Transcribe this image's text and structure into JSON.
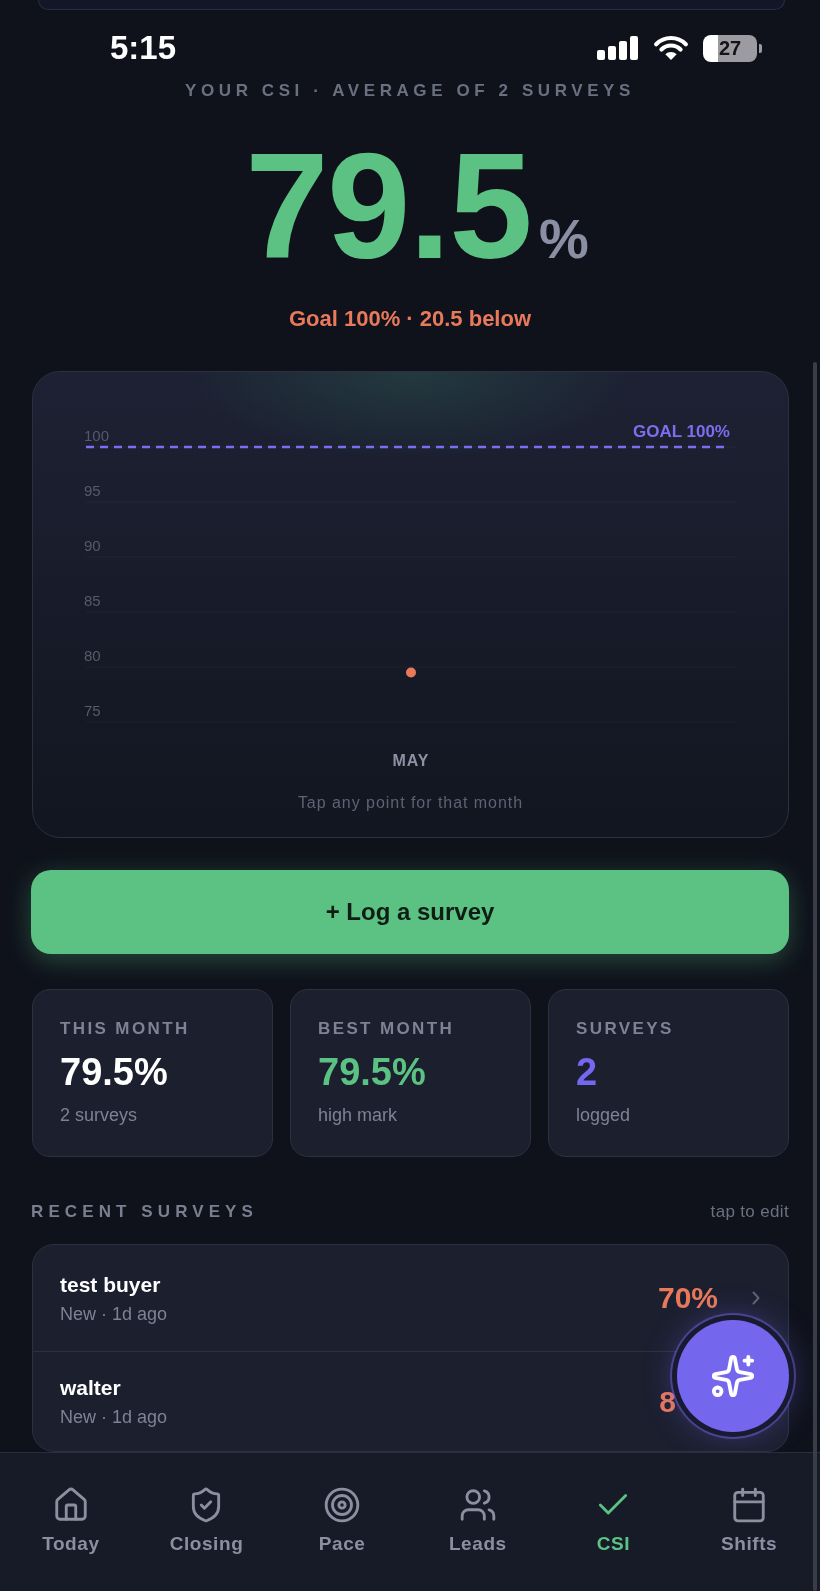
{
  "status_bar": {
    "time": "5:15",
    "battery": "27"
  },
  "header": {
    "subtitle": "YOUR CSI · AVERAGE OF 2 SURVEYS",
    "score": "79.5",
    "unit": "%",
    "goal_note": "Goal 100% · 20.5 below"
  },
  "chart": {
    "caption": "Tap any point for that month",
    "chart_data": {
      "type": "line",
      "categories": [
        "MAY"
      ],
      "series": [
        {
          "color": "#e8795a",
          "marker": "circle",
          "values": [
            79.5
          ]
        }
      ],
      "ylim": [
        75,
        100
      ],
      "yticks": [
        75,
        80,
        85,
        90,
        95,
        100
      ],
      "ref_lines": [
        {
          "axis": "y",
          "value": 100,
          "label": "GOAL 100%",
          "color": "#7b6ff0"
        }
      ]
    }
  },
  "log_button": "+ Log a survey",
  "stats": [
    {
      "label": "THIS MONTH",
      "value": "79.5%",
      "note": "2 surveys",
      "color": "#ffffff"
    },
    {
      "label": "BEST MONTH",
      "value": "79.5%",
      "note": "high mark",
      "color": "#5bc283"
    },
    {
      "label": "SURVEYS",
      "value": "2",
      "note": "logged",
      "color": "#7468f0"
    }
  ],
  "recent": {
    "title": "RECENT SURVEYS",
    "hint": "tap to edit",
    "rows": [
      {
        "name": "test buyer",
        "meta": "New · 1d ago",
        "score": "70%"
      },
      {
        "name": "walter",
        "meta": "New · 1d ago",
        "score": "8"
      }
    ]
  },
  "nav": [
    {
      "label": "Today",
      "selected": false
    },
    {
      "label": "Closing",
      "selected": false
    },
    {
      "label": "Pace",
      "selected": false
    },
    {
      "label": "Leads",
      "selected": false
    },
    {
      "label": "CSI",
      "selected": true
    },
    {
      "label": "Shifts",
      "selected": false
    }
  ]
}
